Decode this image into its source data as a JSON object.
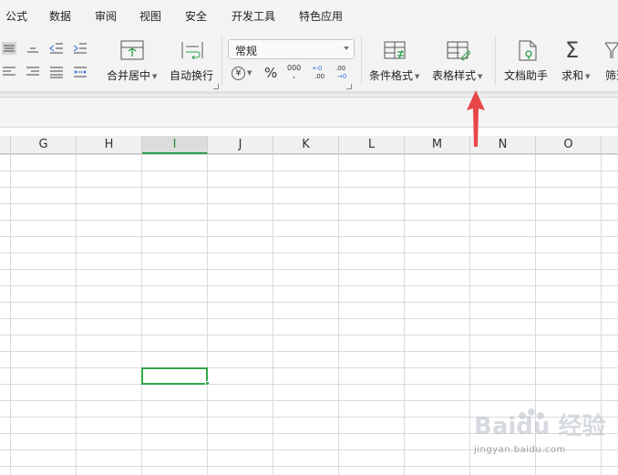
{
  "menubar": {
    "items": [
      "公式",
      "数据",
      "审阅",
      "视图",
      "安全",
      "开发工具",
      "特色应用"
    ]
  },
  "ribbon": {
    "merge_center_label": "合并居中",
    "wrap_text_label": "自动换行",
    "number_format": {
      "value": "常规"
    },
    "currency_symbol": "¥",
    "percent_symbol": "%",
    "thousands_symbol": "000",
    "conditional_format_label": "条件格式",
    "table_style_label": "表格样式",
    "doc_helper_label": "文档助手",
    "sum_label": "求和",
    "filter_label": "筛选"
  },
  "sheet": {
    "columns": [
      "G",
      "H",
      "I",
      "J",
      "K",
      "L",
      "M",
      "N",
      "O"
    ],
    "active_column": "I"
  },
  "watermark": {
    "brand": "Baidu 经验",
    "url": "jingyan.baidu.com"
  },
  "colors": {
    "accent_green": "#35a54a",
    "arrow_red": "#e8474a",
    "ribbon_bg": "#f3f3f3"
  }
}
